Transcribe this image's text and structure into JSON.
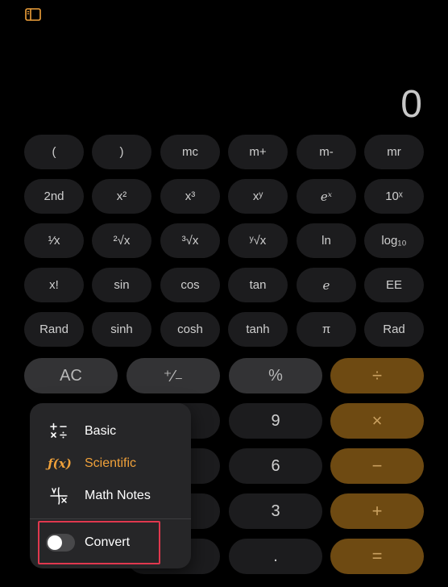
{
  "display": {
    "value": "0"
  },
  "sci_rows": [
    [
      "(",
      ")",
      "mc",
      "m+",
      "m-",
      "mr"
    ],
    [
      "2nd",
      "x²",
      "x³",
      "xʸ",
      "eˣ",
      "10ˣ"
    ],
    [
      "¹⁄x",
      "²√x",
      "³√x",
      "ʸ√x",
      "ln",
      "log₁₀"
    ],
    [
      "x!",
      "sin",
      "cos",
      "tan",
      "e",
      "EE"
    ],
    [
      "Rand",
      "sinh",
      "cosh",
      "tanh",
      "π",
      "Rad"
    ]
  ],
  "main_rows": [
    [
      "AC",
      "⁺⁄₋",
      "%",
      "÷"
    ],
    [
      "",
      "",
      "9",
      "×"
    ],
    [
      "",
      "",
      "6",
      "−"
    ],
    [
      "",
      "",
      "3",
      "+"
    ],
    [
      "",
      "",
      ".",
      "="
    ]
  ],
  "menu": {
    "items": [
      {
        "label": "Basic",
        "icon": "basic-operators-icon",
        "active": false
      },
      {
        "label": "Scientific",
        "icon": "function-icon",
        "active": true
      },
      {
        "label": "Math Notes",
        "icon": "math-notes-icon",
        "active": false
      }
    ],
    "convert_label": "Convert",
    "convert_on": false
  },
  "colors": {
    "background": "#000000",
    "accent": "#f0a13a",
    "operator_bg": "#6e4a12",
    "highlight_border": "#e0384e"
  }
}
